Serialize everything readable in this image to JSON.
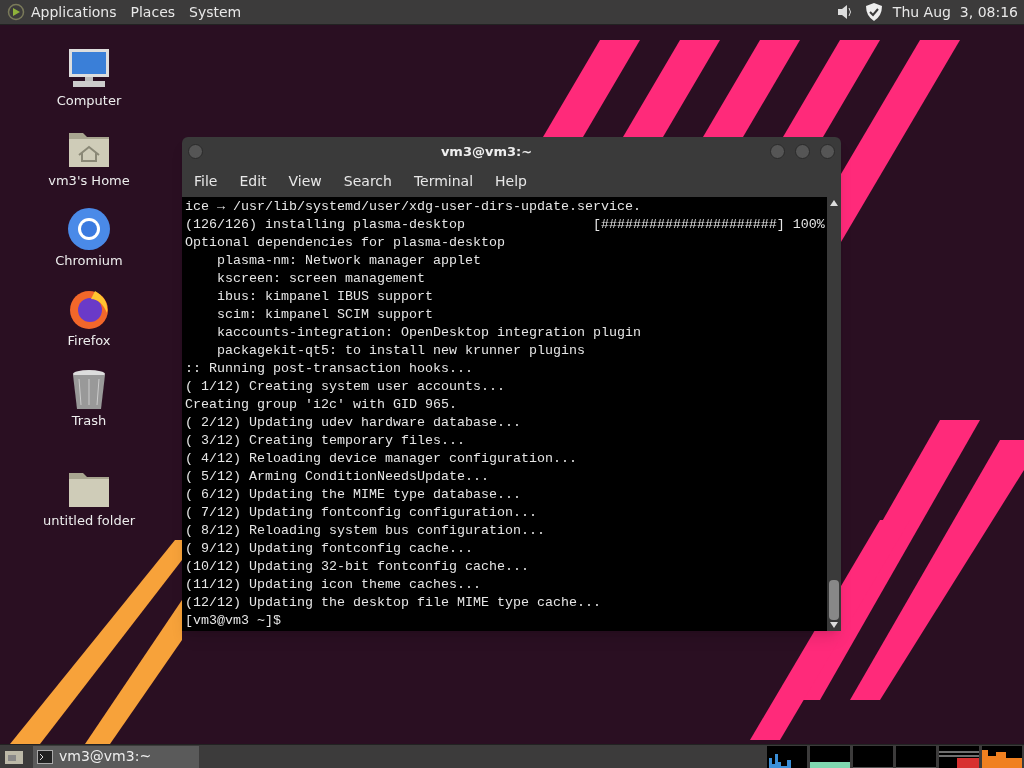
{
  "top_panel": {
    "menus": [
      "Applications",
      "Places",
      "System"
    ],
    "clock": "Thu Aug  3, 08:16"
  },
  "desktop_icons": [
    {
      "kind": "computer",
      "label": "Computer"
    },
    {
      "kind": "home",
      "label": "vm3's Home"
    },
    {
      "kind": "chromium",
      "label": "Chromium"
    },
    {
      "kind": "firefox",
      "label": "Firefox"
    },
    {
      "kind": "trash",
      "label": "Trash"
    },
    {
      "kind": "folder",
      "label": "untitled folder"
    }
  ],
  "terminal": {
    "title": "vm3@vm3:~",
    "menu": [
      "File",
      "Edit",
      "View",
      "Search",
      "Terminal",
      "Help"
    ],
    "lines": [
      "ice → /usr/lib/systemd/user/xdg-user-dirs-update.service.",
      "(126/126) installing plasma-desktop                [######################] 100%",
      "Optional dependencies for plasma-desktop",
      "    plasma-nm: Network manager applet",
      "    kscreen: screen management",
      "    ibus: kimpanel IBUS support",
      "    scim: kimpanel SCIM support",
      "    kaccounts-integration: OpenDesktop integration plugin",
      "    packagekit-qt5: to install new krunner plugins",
      ":: Running post-transaction hooks...",
      "( 1/12) Creating system user accounts...",
      "Creating group 'i2c' with GID 965.",
      "( 2/12) Updating udev hardware database...",
      "( 3/12) Creating temporary files...",
      "( 4/12) Reloading device manager configuration...",
      "( 5/12) Arming ConditionNeedsUpdate...",
      "( 6/12) Updating the MIME type database...",
      "( 7/12) Updating fontconfig configuration...",
      "( 8/12) Reloading system bus configuration...",
      "( 9/12) Updating fontconfig cache...",
      "(10/12) Updating 32-bit fontconfig cache...",
      "(11/12) Updating icon theme caches...",
      "(12/12) Updating the desktop file MIME type cache...",
      "[vm3@vm3 ~]$"
    ]
  },
  "taskbar": {
    "tasks": [
      {
        "label": "vm3@vm3:~",
        "selected": true
      }
    ]
  }
}
